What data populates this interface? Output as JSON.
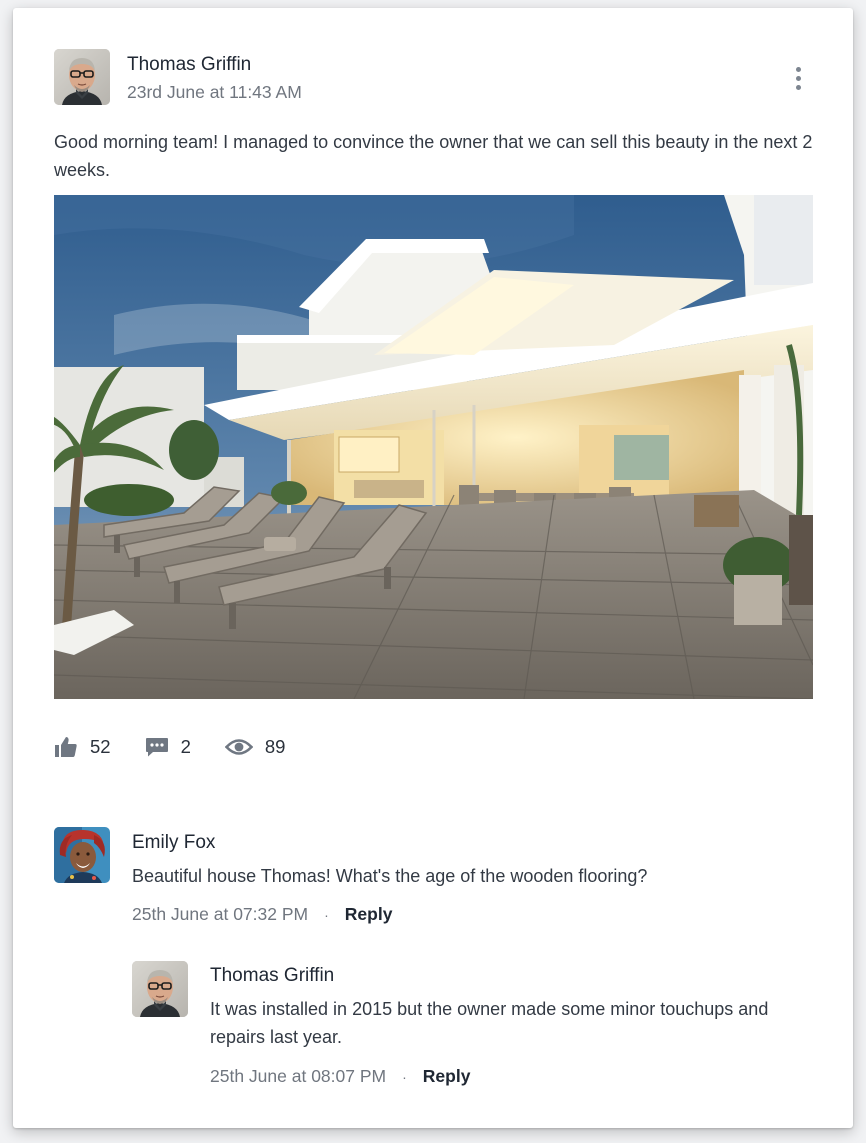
{
  "post": {
    "author": "Thomas Griffin",
    "timestamp": "23rd June at 11:43 AM",
    "text": "Good morning team! I managed to convince the owner that we can sell this beauty in the next 2 weeks.",
    "menu_icon": "more-vertical-icon",
    "image_alt": "Modern beach house with wooden deck and sun loungers at dusk"
  },
  "stats": {
    "likes": {
      "icon": "thumbs-up-icon",
      "count": "52"
    },
    "comments": {
      "icon": "comment-icon",
      "count": "2"
    },
    "views": {
      "icon": "eye-icon",
      "count": "89"
    }
  },
  "comments": [
    {
      "author": "Emily Fox",
      "text": "Beautiful house Thomas! What's the age of the wooden flooring?",
      "timestamp": "25th June at 07:32 PM",
      "separator": "·",
      "reply_label": "Reply",
      "replies": [
        {
          "author": "Thomas Griffin",
          "text": "It was installed in 2015 but the owner made some minor touchups and repairs last year.",
          "timestamp": "25th June at 08:07 PM",
          "separator": "·",
          "reply_label": "Reply"
        }
      ]
    }
  ],
  "colors": {
    "icon_gray": "#6f7782",
    "text_primary": "#1f2733",
    "text_muted": "#70767f"
  }
}
